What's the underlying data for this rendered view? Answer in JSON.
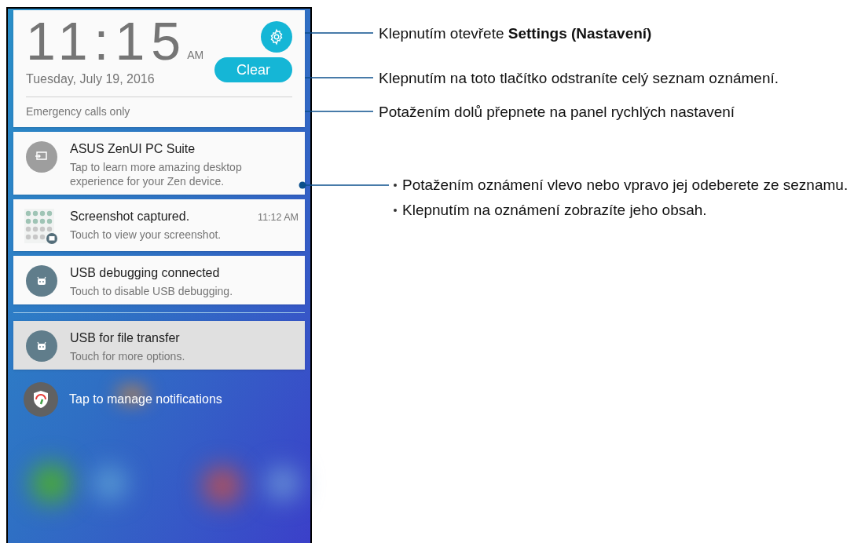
{
  "clock": {
    "time": "11:15",
    "ampm": "AM",
    "date": "Tuesday, July 19, 2016"
  },
  "clear_button": "Clear",
  "status": "Emergency calls only",
  "notifications": [
    {
      "kind": "suite",
      "title": "ASUS ZenUI PC Suite",
      "text": "Tap to learn more amazing desktop experience for your Zen device.",
      "highlighted": false
    },
    {
      "kind": "screenshot",
      "title": "Screenshot captured.",
      "text": "Touch to view your screenshot.",
      "time": "11:12 AM",
      "highlighted": false
    },
    {
      "kind": "android",
      "title": "USB debugging connected",
      "text": "Touch to disable USB debugging.",
      "highlighted": false
    }
  ],
  "ongoing": [
    {
      "kind": "android",
      "title": "USB for file transfer",
      "text": "Touch for more options.",
      "highlighted": true
    }
  ],
  "manage": "Tap to manage notifications",
  "callouts": [
    {
      "text": "Klepnutím otevřete **Settings (Nastavení)**"
    },
    {
      "text": "Klepnutím na toto tlačítko odstraníte celý seznam oznámení."
    },
    {
      "text": "Potažením dolů přepnete na panel rychlých nastavení"
    },
    {
      "bullets": [
        "Potažením oznámení vlevo nebo vpravo jej odeberete ze seznamu.",
        "Klepnutím na oznámení zobrazíte jeho obsah."
      ]
    }
  ]
}
